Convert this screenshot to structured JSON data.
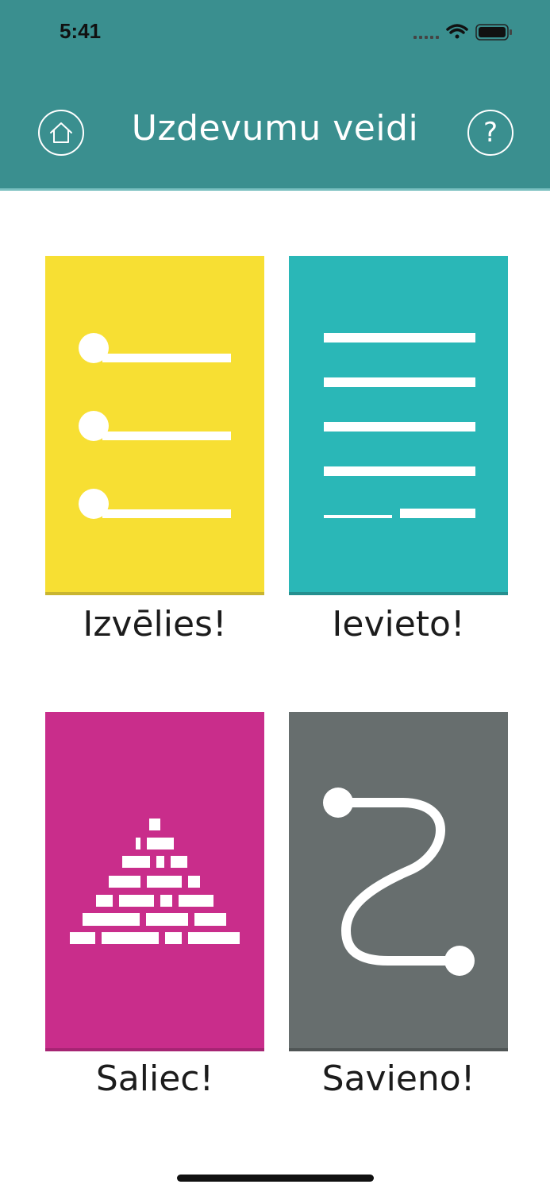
{
  "status_bar": {
    "time": "5:41",
    "icons": [
      "signal-icon",
      "wifi-icon",
      "battery-icon"
    ]
  },
  "header": {
    "title": "Uzdevumu veidi",
    "home_icon": "home-icon",
    "help_label": "?",
    "background": "#3a8f8f"
  },
  "cards": [
    {
      "label": "Izvēlies!",
      "color": "#f7df33",
      "icon": "choice-list-icon"
    },
    {
      "label": "Ievieto!",
      "color": "#2ab7b7",
      "icon": "fill-in-lines-icon"
    },
    {
      "label": "Saliec!",
      "color": "#c92d8b",
      "icon": "pyramid-blocks-icon"
    },
    {
      "label": "Savieno!",
      "color": "#676e6e",
      "icon": "connect-path-icon"
    }
  ]
}
